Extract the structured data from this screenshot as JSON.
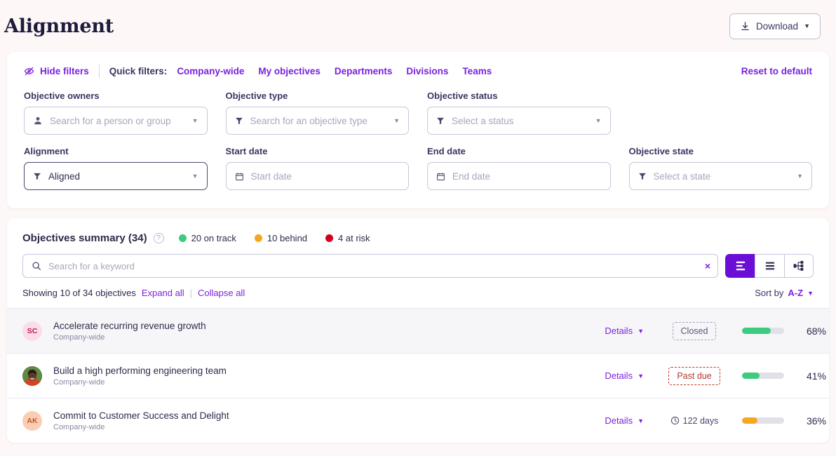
{
  "header": {
    "title": "Alignment",
    "download_label": "Download",
    "download_icon": "download-icon"
  },
  "filters": {
    "hide_filters_label": "Hide filters",
    "hide_filters_icon": "eye-off-icon",
    "quick_filters_label": "Quick filters:",
    "quick_links": [
      {
        "label": "Company-wide"
      },
      {
        "label": "My objectives"
      },
      {
        "label": "Departments"
      },
      {
        "label": "Divisions"
      },
      {
        "label": "Teams"
      }
    ],
    "reset_label": "Reset to default",
    "fields": [
      {
        "label": "Objective owners",
        "placeholder": "Search for a person or group",
        "value": "",
        "icon": "person-icon",
        "active": false
      },
      {
        "label": "Objective type",
        "placeholder": "Search for an objective type",
        "value": "",
        "icon": "filter-icon",
        "active": false
      },
      {
        "label": "Objective status",
        "placeholder": "Select a status",
        "value": "",
        "icon": "filter-icon",
        "active": false
      },
      {
        "label": "Alignment",
        "placeholder": "",
        "value": "Aligned",
        "icon": "filter-icon",
        "active": true
      },
      {
        "label": "Start date",
        "placeholder": "Start date",
        "value": "",
        "icon": "calendar-icon",
        "active": false
      },
      {
        "label": "End date",
        "placeholder": "End date",
        "value": "",
        "icon": "calendar-icon",
        "active": false
      },
      {
        "label": "Objective state",
        "placeholder": "Select a state",
        "value": "",
        "icon": "filter-icon",
        "active": false
      }
    ]
  },
  "summary": {
    "title": "Objectives summary (34)",
    "help_icon": "question-mark-icon",
    "stats": [
      {
        "label": "20 on track",
        "color": "#3CCB7F"
      },
      {
        "label": "10 behind",
        "color": "#F5A623"
      },
      {
        "label": "4 at risk",
        "color": "#D0021B"
      }
    ]
  },
  "search": {
    "placeholder": "Search for a keyword",
    "value": "",
    "icon": "search-icon",
    "clear_icon": "close-icon",
    "clear_label": "×"
  },
  "view_toggle": {
    "options": [
      {
        "name": "alignment-view",
        "active": true
      },
      {
        "name": "list-view",
        "active": false
      },
      {
        "name": "tree-view",
        "active": false
      }
    ]
  },
  "listing": {
    "showing_text": "Showing 10 of 34 objectives",
    "expand_all": "Expand all",
    "collapse_all": "Collapse all",
    "sort_label": "Sort by",
    "sort_value": "A-Z"
  },
  "objectives": [
    {
      "name": "Accelerate recurring revenue growth",
      "scope": "Company-wide",
      "avatar_initials": "SC",
      "avatar_type": "initials",
      "avatar_bg": "#FBDDEA",
      "avatar_fg": "#C2185B",
      "details_label": "Details",
      "status_label": "Closed",
      "status_type": "chip",
      "progress": 68,
      "progress_text": "68%",
      "progress_color": "#3CCB7F",
      "selected": true
    },
    {
      "name": "Build a high performing engineering team",
      "scope": "Company-wide",
      "avatar_initials": "",
      "avatar_type": "photo",
      "avatar_bg": "#4E7A3C",
      "avatar_fg": "#ffffff",
      "details_label": "Details",
      "status_label": "Past due",
      "status_type": "chip-pastdue",
      "progress": 41,
      "progress_text": "41%",
      "progress_color": "#3CCB7F",
      "selected": false
    },
    {
      "name": "Commit to Customer Success and Delight",
      "scope": "Company-wide",
      "avatar_initials": "AK",
      "avatar_type": "initials",
      "avatar_bg": "#FBCDB4",
      "avatar_fg": "#C0562B",
      "details_label": "Details",
      "status_label": "122 days",
      "status_type": "clock",
      "progress": 36,
      "progress_text": "36%",
      "progress_color": "#F5A623",
      "selected": false
    }
  ]
}
